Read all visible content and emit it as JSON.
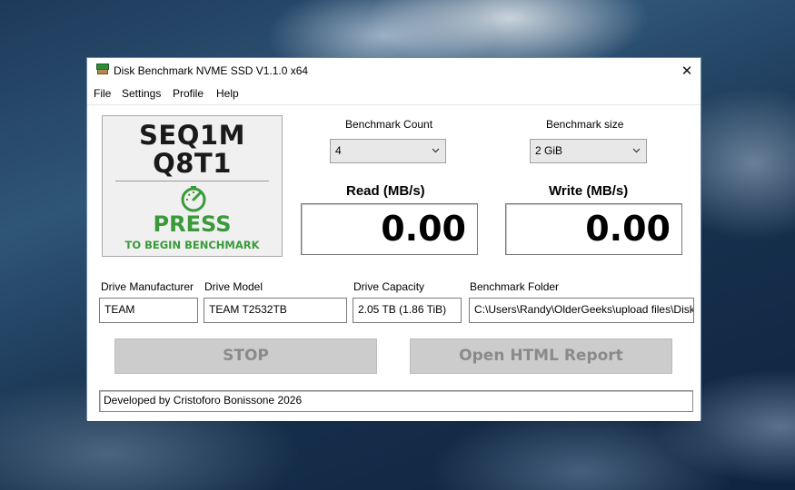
{
  "window": {
    "title": "Disk Benchmark NVME SSD V1.1.0 x64",
    "close_glyph": "✕"
  },
  "menu": [
    {
      "label": "File"
    },
    {
      "label": "Settings"
    },
    {
      "label": "Profile"
    },
    {
      "label": "Help"
    }
  ],
  "benchmark_button": {
    "line1": "SEQ1M",
    "line2": "Q8T1",
    "press": "PRESS",
    "subtitle": "TO BEGIN BENCHMARK",
    "icon": "speedometer-icon",
    "accent": "#3a9a3a"
  },
  "benchmark_count": {
    "label": "Benchmark Count",
    "value": "4"
  },
  "benchmark_size": {
    "label": "Benchmark size",
    "value": "2 GiB"
  },
  "read": {
    "label": "Read (MB/s)",
    "value": "0.00"
  },
  "write": {
    "label": "Write (MB/s)",
    "value": "0.00"
  },
  "drive": {
    "manufacturer_label": "Drive Manufacturer",
    "manufacturer": "TEAM",
    "model_label": "Drive Model",
    "model": "TEAM T2532TB",
    "capacity_label": "Drive Capacity",
    "capacity": "2.05 TB (1.86 TiB)",
    "folder_label": "Benchmark Folder",
    "folder": "C:\\Users\\Randy\\OlderGeeks\\upload files\\Disk"
  },
  "buttons": {
    "stop": "STOP",
    "report": "Open HTML Report"
  },
  "status": "Developed by Cristoforo Bonissone 2026"
}
